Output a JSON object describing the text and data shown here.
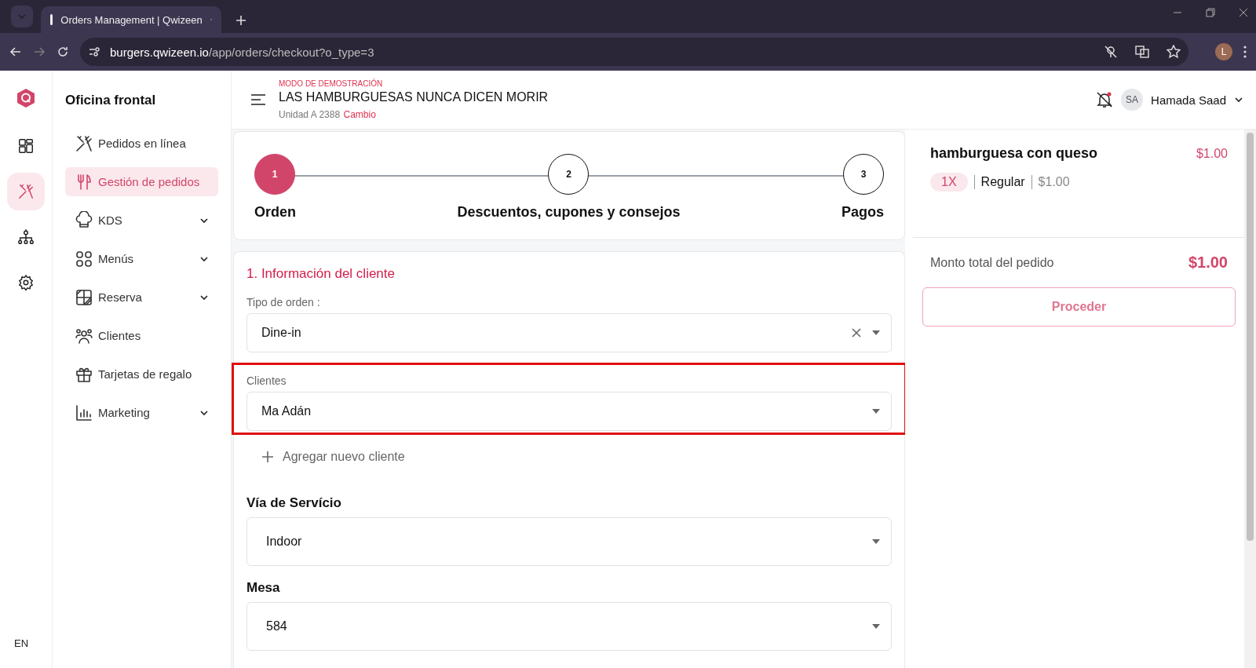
{
  "browser": {
    "tabs": [
      {
        "title": "Orders Management | Qwizeen",
        "selected": true
      }
    ],
    "url": {
      "host": "burgers.qwizeen.io",
      "path": "/app/orders/checkout?o_type=3"
    },
    "profile": "L"
  },
  "rail": {
    "items": [
      {
        "selected": false
      },
      {
        "selected": true
      },
      {
        "selected": false
      },
      {
        "selected": false
      }
    ],
    "language": "EN"
  },
  "sidebar": {
    "title": "Oficina frontal",
    "items": [
      {
        "label": "Pedidos en línea",
        "selected": false,
        "expandable": false
      },
      {
        "label": "Gestión de pedidos",
        "selected": true,
        "expandable": false
      },
      {
        "label": "KDS",
        "selected": false,
        "expandable": true
      },
      {
        "label": "Menús",
        "selected": false,
        "expandable": true
      },
      {
        "label": "Reserva",
        "selected": false,
        "expandable": true
      },
      {
        "label": "Clientes",
        "selected": false,
        "expandable": false
      },
      {
        "label": "Tarjetas de regalo",
        "selected": false,
        "expandable": false
      },
      {
        "label": "Marketing",
        "selected": false,
        "expandable": true
      }
    ]
  },
  "header": {
    "demo_label": "MODO DE DEMOSTRACIÓN",
    "restaurant": "LAS HAMBURGUESAS NUNCA DICEN MORIR",
    "unit": "Unidad A 2388",
    "change_link": "Cambio",
    "user": {
      "initials": "SA",
      "name": "Hamada Saad"
    }
  },
  "steps": [
    {
      "number": "1",
      "label": "Orden",
      "selected": true
    },
    {
      "number": "2",
      "label": "Descuentos, cupones y consejos",
      "selected": false
    },
    {
      "number": "3",
      "label": "Pagos",
      "selected": false
    }
  ],
  "form": {
    "title": "1. Información del cliente",
    "fields": [
      {
        "label": "Tipo de orden :",
        "value": "Dine-in",
        "clearable": true,
        "highlighted": false
      },
      {
        "label": "Clientes",
        "value": "Ma Adán",
        "clearable": false,
        "highlighted": true
      }
    ],
    "add_customer": "Agregar nuevo cliente",
    "selects": [
      {
        "label": "Vía de Servício",
        "value": "Indoor"
      },
      {
        "label": "Mesa",
        "value": "584"
      }
    ]
  },
  "cart": {
    "items": [
      {
        "name": "hamburguesa con queso",
        "price": "$1.00",
        "quantity": "1X",
        "variant": "Regular",
        "unit_price": "$1.00"
      }
    ],
    "total_label": "Monto total del pedido",
    "total": "$1.00",
    "proceed": "Proceder"
  }
}
